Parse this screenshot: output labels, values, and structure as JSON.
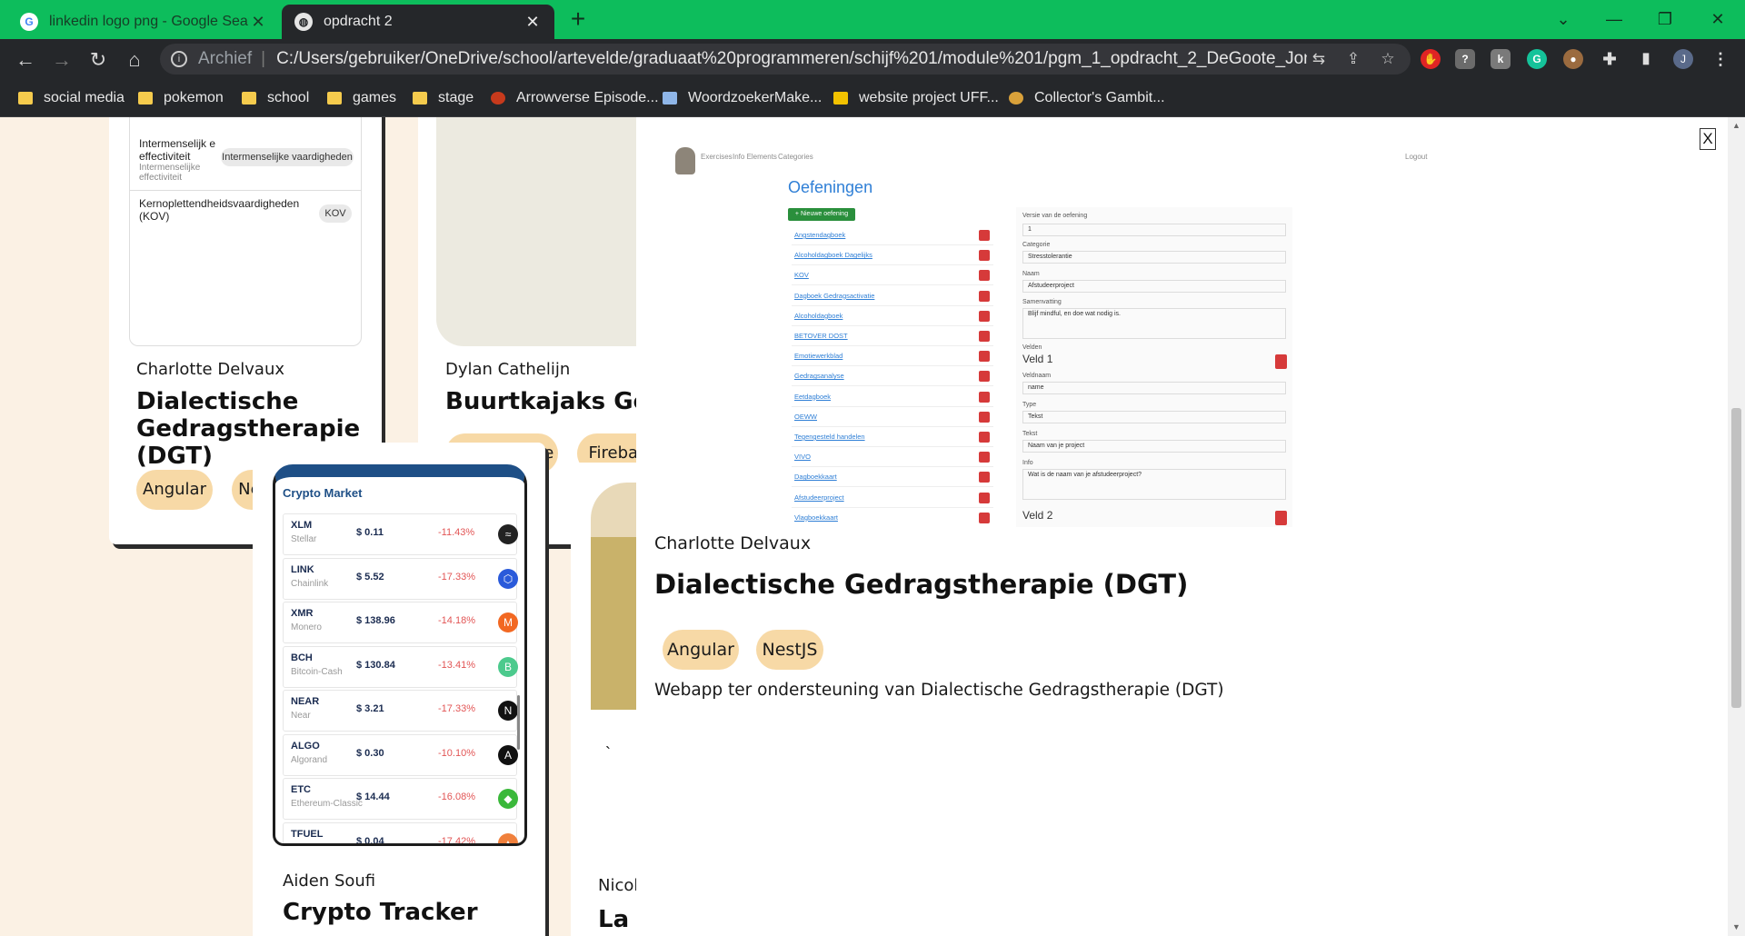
{
  "browser": {
    "tabs": [
      {
        "title": "linkedin logo png - Google Search"
      },
      {
        "title": "opdracht 2"
      }
    ],
    "address": {
      "scheme_label": "Archief",
      "url": "C:/Users/gebruiker/OneDrive/school/artevelde/graduaat%20programmeren/schijf%201/module%201/pgm_1_opdracht_2_DeGoote_Jonas/app/i..."
    },
    "profile_initial": "J",
    "bookmarks": [
      {
        "label": "social media",
        "icon": "folder-icon"
      },
      {
        "label": "pokemon",
        "icon": "folder-icon"
      },
      {
        "label": "school",
        "icon": "folder-icon"
      },
      {
        "label": "games",
        "icon": "folder-icon"
      },
      {
        "label": "stage",
        "icon": "folder-icon"
      },
      {
        "label": "Arrowverse Episode...",
        "icon": "flash-icon"
      },
      {
        "label": "WoordzoekerMake...",
        "icon": "search-icon"
      },
      {
        "label": "website project UFF...",
        "icon": "m-logo-icon"
      },
      {
        "label": "Collector's Gambit...",
        "icon": "gambit-icon"
      }
    ]
  },
  "cards": {
    "dgt": {
      "author": "Charlotte Delvaux",
      "title": "Dialectische Gedragstherapie (DGT)",
      "tags": [
        "Angular",
        "NestJS"
      ],
      "skills": [
        {
          "name": "Intermenselijk e effectiviteit",
          "sub": "Intermenselijke effectiviteit",
          "badge": "Intermenselijke vaardigheden"
        },
        {
          "name": "Kernoplettendheidsvaardigheden (KOV)",
          "sub": "",
          "badge": "KOV"
        }
      ]
    },
    "buurtkajaks": {
      "author": "Dylan Cathelijn",
      "title": "Buurtkajaks Gent",
      "tags": [
        "React Native",
        "Firebase"
      ]
    },
    "crypto": {
      "author": "Aiden Soufi",
      "title": "Crypto Tracker",
      "app_title": "Crypto Market",
      "coins": [
        {
          "sym": "XLM",
          "name": "Stellar",
          "price": "$ 0.11",
          "change": "-11.43%",
          "color": "#222222",
          "glyph": "≈"
        },
        {
          "sym": "LINK",
          "name": "Chainlink",
          "price": "$ 5.52",
          "change": "-17.33%",
          "color": "#2a5ada",
          "glyph": "⬡"
        },
        {
          "sym": "XMR",
          "name": "Monero",
          "price": "$ 138.96",
          "change": "-14.18%",
          "color": "#f26822",
          "glyph": "M"
        },
        {
          "sym": "BCH",
          "name": "Bitcoin-Cash",
          "price": "$ 130.84",
          "change": "-13.41%",
          "color": "#4cca8d",
          "glyph": "B"
        },
        {
          "sym": "NEAR",
          "name": "Near",
          "price": "$ 3.21",
          "change": "-17.33%",
          "color": "#111111",
          "glyph": "N"
        },
        {
          "sym": "ALGO",
          "name": "Algorand",
          "price": "$ 0.30",
          "change": "-10.10%",
          "color": "#111111",
          "glyph": "A"
        },
        {
          "sym": "ETC",
          "name": "Ethereum-Classic",
          "price": "$ 14.44",
          "change": "-16.08%",
          "color": "#3ab83a",
          "glyph": "◆"
        },
        {
          "sym": "TFUEL",
          "name": "",
          "price": "$ 0.04",
          "change": "-17.42%",
          "color": "#f0803c",
          "glyph": "▲"
        }
      ]
    },
    "partial": {
      "author": "Nicol",
      "title": "La I",
      "quote_mark": "`"
    }
  },
  "modal": {
    "close_label": "X",
    "author": "Charlotte Delvaux",
    "title": "Dialectische Gedragstherapie (DGT)",
    "tags": [
      "Angular",
      "NestJS"
    ],
    "description": "Webapp ter ondersteuning van Dialectische Gedragstherapie (DGT)",
    "screenshot": {
      "nav": [
        "Exercises",
        "Info Elements",
        "Categories"
      ],
      "logout": "Logout",
      "heading": "Oefeningen",
      "new_button": "+ Nieuwe oefening",
      "exercises": [
        "Angstendagboek",
        "Alcoholdagboek Dagelijks",
        "KOV",
        "Dagboek Gedragsactivatie",
        "Alcoholdagboek",
        "BETOVER DOST",
        "Emotiewerkblad",
        "Gedragsanalyse",
        "Eetdagboek",
        "OEWW",
        "Tegengesteld handelen",
        "VIVO",
        "Dagboekkaart",
        "Afstudeerproject",
        "Vlagboekkaart"
      ],
      "form": {
        "version_label": "Versie van de oefening",
        "version_value": "1",
        "category_label": "Categorie",
        "category_value": "Stresstolerantie",
        "name_label": "Naam",
        "name_value": "Afstudeerproject",
        "summary_label": "Samenvatting",
        "summary_value": "Blijf mindful, en doe wat nodig is.",
        "fields_label": "Velden",
        "field1_title": "Veld 1",
        "fieldname_label": "Veldnaam",
        "fieldname_value": "name",
        "type_label": "Type",
        "type_value": "Tekst",
        "text_label": "Tekst",
        "text_value": "Naam van je project",
        "info_label": "Info",
        "info_value": "Wat is de naam van je afstudeerproject?",
        "field2_title": "Veld 2"
      }
    }
  }
}
